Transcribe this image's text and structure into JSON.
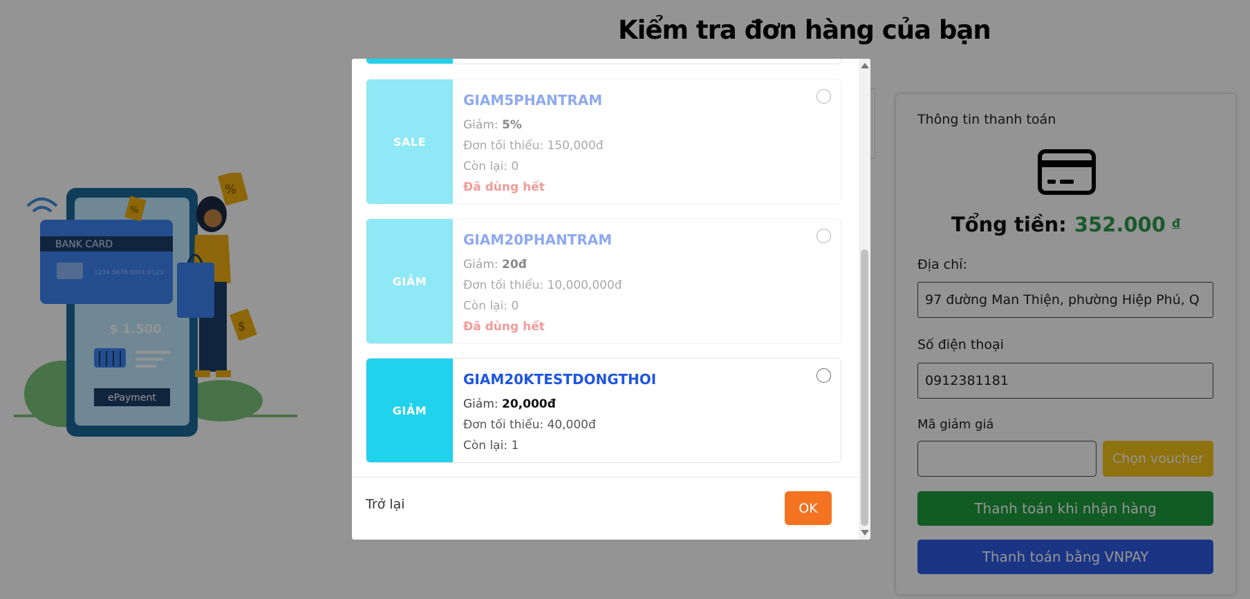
{
  "page": {
    "title": "Kiểm tra đơn hàng của bạn"
  },
  "illustration": {
    "bank_card": "BANK CARD",
    "card_number": "1234 5678 0001 0123",
    "amount": "$ 1.500",
    "epayment": "ePayment"
  },
  "payment": {
    "heading": "Thông tin thanh toán",
    "total_label": "Tổng tiền:",
    "total_value": "352.000",
    "currency": "đ",
    "address_label": "Địa chỉ:",
    "address_value": "97 đường Man Thiện, phường Hiệp Phú, Q",
    "phone_label": "Số điện thoại",
    "phone_value": "0912381181",
    "discount_label": "Mã giảm giá",
    "choose_voucher": "Chọn voucher",
    "cod_button": "Thanh toán khi nhận hàng",
    "vnpay_button": "Thanh toán bằng VNPAY"
  },
  "modal": {
    "vouchers": [
      {
        "badge": "SALE",
        "code": "GIAM5PHANTRAM",
        "discount_label": "Giảm:",
        "discount_value": "5%",
        "min_order": "Đơn tối thiểu: 150,000đ",
        "remaining": "Còn lại: 0",
        "status": "Đã dùng hết"
      },
      {
        "badge": "GIẢM",
        "code": "GIAM20PHANTRAM",
        "discount_label": "Giảm:",
        "discount_value": "20đ",
        "min_order": "Đơn tối thiểu: 10,000,000đ",
        "remaining": "Còn lại: 0",
        "status": "Đã dùng hết"
      },
      {
        "badge": "GIẢM",
        "code": "GIAM20KTESTDONGTHOI",
        "discount_label": "Giảm:",
        "discount_value": "20,000đ",
        "min_order": "Đơn tối thiểu: 40,000đ",
        "remaining": "Còn lại: 1"
      }
    ],
    "back": "Trở lại",
    "ok": "OK"
  },
  "colors": {
    "voucher_band": "#21d2ec",
    "code_blue": "#1f56e0",
    "used_red": "#e53935",
    "ok_orange": "#f47321",
    "total_green": "#2e9a4f",
    "voucher_btn_yellow": "#f5c518",
    "cod_green": "#1e9e3e",
    "vnpay_blue": "#2f5ce6"
  }
}
